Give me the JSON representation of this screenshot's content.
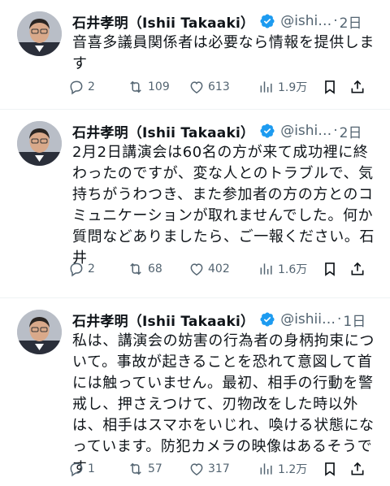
{
  "tweets": [
    {
      "name": "石井孝明（Ishii Takaaki）",
      "handle": "@ishi…",
      "separator": "·",
      "time": "2日",
      "text": "音喜多議員関係者は必要なら情報を提供します",
      "replies": "2",
      "retweets": "109",
      "likes": "613",
      "views": "1.9万"
    },
    {
      "name": "石井孝明（Ishii Takaaki）",
      "handle": "@ishi…",
      "separator": "·",
      "time": "2日",
      "text": "2月2日講演会は60名の方が来て成功裡に終わったのですが、変な人とのトラブルで、気持ちがうわつき、また参加者の方の方とのコミュニケーションが取れませんでした。何か質問などありましたら、ご一報ください。石井",
      "replies": "2",
      "retweets": "68",
      "likes": "402",
      "views": "1.6万"
    },
    {
      "name": "石井孝明（Ishii Takaaki）",
      "handle": "@ishii…",
      "separator": "·",
      "time": "1日",
      "text": "私は、講演会の妨害の行為者の身柄拘束について。事故が起きることを恐れて意図して首には触っていません。最初、相手の行動を警戒し、押さえつけて、刃物改をした時以外は、相手はスマホをいじれ、喚ける状態になっています。防犯カメラの映像はあるそうです",
      "replies": "1",
      "retweets": "57",
      "likes": "317",
      "views": "1.2万"
    }
  ],
  "colors": {
    "text": "#0f1419",
    "secondary": "#536471",
    "verified": "#1d9bf0",
    "divider": "#eff3f4"
  },
  "icons": [
    "reply-icon",
    "retweet-icon",
    "like-icon",
    "views-icon",
    "bookmark-icon",
    "share-icon",
    "verified-badge-icon"
  ]
}
